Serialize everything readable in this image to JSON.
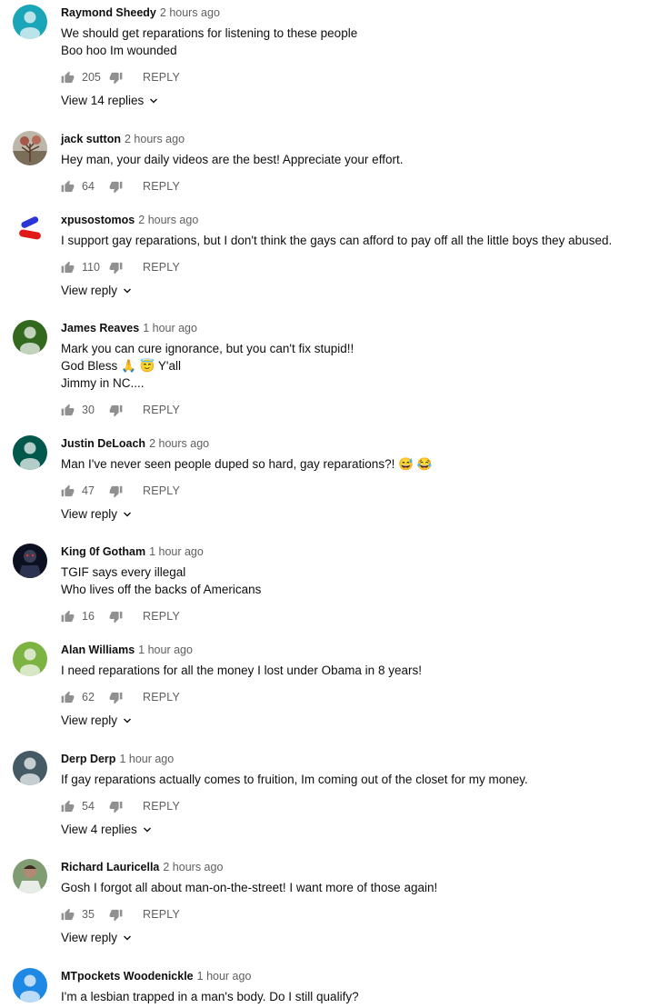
{
  "colors": {
    "text": "#0f0f0f",
    "meta": "#606060",
    "icon": "#909090"
  },
  "comments": [
    {
      "author": "Raymond Sheedy",
      "time": "2 hours ago",
      "lines": [
        "We should get reparations for listening to these people",
        "Boo hoo Im wounded"
      ],
      "likes": "205",
      "reply_label": "REPLY",
      "view_replies": "View 14 replies",
      "avatar_color": "#1ba5b8",
      "avatar_type": "default"
    },
    {
      "author": "jack sutton",
      "time": "2 hours ago",
      "lines": [
        "Hey man, your daily videos are the best! Appreciate your effort."
      ],
      "likes": "64",
      "reply_label": "REPLY",
      "view_replies": "",
      "avatar_color": "#8f8c85",
      "avatar_type": "photo-tree"
    },
    {
      "author": "xpusostomos",
      "time": "2 hours ago",
      "lines": [
        "I support gay reparations, but I don't think the gays can afford to pay off all the little boys they abused."
      ],
      "likes": "110",
      "reply_label": "REPLY",
      "view_replies": "View reply",
      "avatar_color": "#ffffff",
      "avatar_type": "pills"
    },
    {
      "author": "James Reaves",
      "time": "1 hour ago",
      "lines": [
        "Mark you can cure ignorance, but you can't fix stupid!!",
        "God Bless 🙏 😇  Y'all",
        "Jimmy in NC...."
      ],
      "likes": "30",
      "reply_label": "REPLY",
      "view_replies": "",
      "avatar_color": "#33691e",
      "avatar_type": "default"
    },
    {
      "author": "Justin DeLoach",
      "time": "2 hours ago",
      "lines": [
        "Man I've never seen people duped so hard, gay reparations?! 😅 😂"
      ],
      "likes": "47",
      "reply_label": "REPLY",
      "view_replies": "View reply",
      "avatar_color": "#00574b",
      "avatar_type": "default"
    },
    {
      "author": "King 0f Gotham",
      "time": "1 hour ago",
      "lines": [
        "TGIF says every illegal",
        "Who lives off the backs of Americans"
      ],
      "likes": "16",
      "reply_label": "REPLY",
      "view_replies": "",
      "avatar_color": "#1a1f2e",
      "avatar_type": "photo-dark"
    },
    {
      "author": "Alan Williams",
      "time": "1 hour ago",
      "lines": [
        "I need reparations for all the money I lost under Obama in 8 years!"
      ],
      "likes": "62",
      "reply_label": "REPLY",
      "view_replies": "View reply",
      "avatar_color": "#7cb342",
      "avatar_type": "default"
    },
    {
      "author": "Derp Derp",
      "time": "1 hour ago",
      "lines": [
        "If gay reparations actually comes to fruition, Im coming out of the closet for my money."
      ],
      "likes": "54",
      "reply_label": "REPLY",
      "view_replies": "View 4 replies",
      "avatar_color": "#455a64",
      "avatar_type": "default"
    },
    {
      "author": "Richard Lauricella",
      "time": "2 hours ago",
      "lines": [
        "Gosh I forgot all about man-on-the-street! I want more of those again!"
      ],
      "likes": "35",
      "reply_label": "REPLY",
      "view_replies": "View reply",
      "avatar_color": "#6d7a5a",
      "avatar_type": "photo-person"
    },
    {
      "author": "MTpockets Woodenickle",
      "time": "1 hour ago",
      "lines": [
        "I'm a lesbian trapped in a man's body. Do I still qualify?"
      ],
      "likes": "",
      "reply_label": "",
      "view_replies": "",
      "avatar_color": "#1e88e5",
      "avatar_type": "default"
    }
  ]
}
